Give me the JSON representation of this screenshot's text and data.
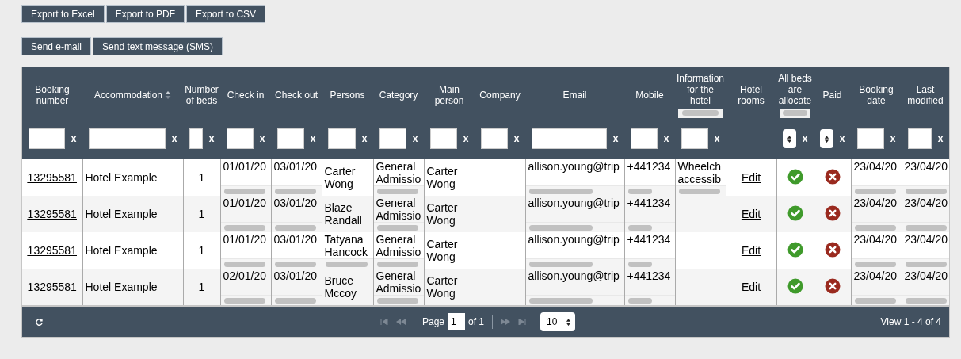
{
  "export_buttons": [
    "Export  to Excel",
    "Export to PDF",
    "Export to CSV"
  ],
  "message_buttons": [
    "Send e-mail",
    "Send text message (SMS)"
  ],
  "table": {
    "columns": [
      {
        "label": "Booking number",
        "kind": "link",
        "filter": {
          "kind": "text",
          "clear": "x"
        }
      },
      {
        "label": "Accommodation",
        "sortable": true,
        "kind": "text",
        "filter": {
          "kind": "text",
          "clear": "x"
        }
      },
      {
        "label": "Number of beds",
        "kind": "center",
        "filter": {
          "kind": "text",
          "clear": "x"
        }
      },
      {
        "label": "Check in",
        "kind": "text",
        "filter": {
          "kind": "text",
          "clear": "x"
        }
      },
      {
        "label": "Check out",
        "kind": "text",
        "filter": {
          "kind": "text",
          "clear": "x"
        }
      },
      {
        "label": "Persons",
        "kind": "text",
        "filter": {
          "kind": "text",
          "clear": "x"
        }
      },
      {
        "label": "Category",
        "kind": "text",
        "filter": {
          "kind": "text",
          "clear": "x"
        }
      },
      {
        "label": "Main person",
        "kind": "text",
        "filter": {
          "kind": "text",
          "clear": "x"
        }
      },
      {
        "label": "Company",
        "kind": "text",
        "filter": {
          "kind": "text",
          "clear": "x"
        }
      },
      {
        "label": "Email",
        "kind": "text",
        "filter": {
          "kind": "text",
          "clear": "x"
        }
      },
      {
        "label": "Mobile",
        "kind": "text",
        "filter": {
          "kind": "text",
          "clear": "x"
        }
      },
      {
        "label": "Information for the hotel",
        "header_scrollbar": true,
        "kind": "text",
        "filter": {
          "kind": "text",
          "clear": "x"
        }
      },
      {
        "label": "Hotel rooms",
        "kind": "link"
      },
      {
        "label": "All beds are allocate",
        "header_scrollbar": true,
        "kind": "status",
        "filter": {
          "kind": "select",
          "clear": "x"
        }
      },
      {
        "label": "Paid",
        "kind": "status",
        "filter": {
          "kind": "select",
          "clear": "x"
        }
      },
      {
        "label": "Booking date",
        "kind": "text",
        "filter": {
          "kind": "text",
          "clear": "x"
        }
      },
      {
        "label": "Last modified",
        "kind": "text",
        "filter": {
          "kind": "text",
          "clear": "x"
        }
      }
    ],
    "rows": [
      [
        "13295581",
        "Hotel Example",
        "1",
        {
          "text": "01/01/20",
          "scrollbar": true
        },
        {
          "text": "03/01/20",
          "scrollbar": true
        },
        "Carter Wong",
        {
          "text": "General Admissio",
          "scrollbar": true
        },
        "Carter Wong",
        "",
        {
          "text": "allison.young@trip",
          "scrollbar": true
        },
        {
          "text": "+441234",
          "scrollbar": true
        },
        {
          "text": "Wheelch accessib",
          "scrollbar": true
        },
        "Edit",
        true,
        false,
        {
          "text": "23/04/20",
          "scrollbar": true
        },
        {
          "text": "23/04/20",
          "scrollbar": true
        }
      ],
      [
        "13295581",
        "Hotel Example",
        "1",
        {
          "text": "01/01/20",
          "scrollbar": true
        },
        {
          "text": "03/01/20",
          "scrollbar": true
        },
        "Blaze Randall",
        {
          "text": "General Admissio",
          "scrollbar": true
        },
        "Carter Wong",
        "",
        {
          "text": "allison.young@trip",
          "scrollbar": true
        },
        {
          "text": "+441234",
          "scrollbar": true
        },
        "",
        "Edit",
        true,
        false,
        {
          "text": "23/04/20",
          "scrollbar": true
        },
        {
          "text": "23/04/20",
          "scrollbar": true
        }
      ],
      [
        "13295581",
        "Hotel Example",
        "1",
        {
          "text": "01/01/20",
          "scrollbar": true
        },
        {
          "text": "03/01/20",
          "scrollbar": true
        },
        {
          "text": "Tatyana Hancock",
          "scrollbar": true
        },
        {
          "text": "General Admissio",
          "scrollbar": true
        },
        "Carter Wong",
        "",
        {
          "text": "allison.young@trip",
          "scrollbar": true
        },
        {
          "text": "+441234",
          "scrollbar": true
        },
        "",
        "Edit",
        true,
        false,
        {
          "text": "23/04/20",
          "scrollbar": true
        },
        {
          "text": "23/04/20",
          "scrollbar": true
        }
      ],
      [
        "13295581",
        "Hotel Example",
        "1",
        {
          "text": "02/01/20",
          "scrollbar": true
        },
        {
          "text": "03/01/20",
          "scrollbar": true
        },
        "Bruce Mccoy",
        {
          "text": "General Admissio",
          "scrollbar": true
        },
        "Carter Wong",
        "",
        {
          "text": "allison.young@trip",
          "scrollbar": true
        },
        {
          "text": "+441234",
          "scrollbar": true
        },
        "",
        "Edit",
        true,
        false,
        {
          "text": "23/04/20",
          "scrollbar": true
        },
        {
          "text": "23/04/20",
          "scrollbar": true
        }
      ]
    ]
  },
  "pager": {
    "page_label": "Page",
    "page": "1",
    "of": "of 1",
    "page_size": "10",
    "view": "View 1 - 4 of 4"
  }
}
